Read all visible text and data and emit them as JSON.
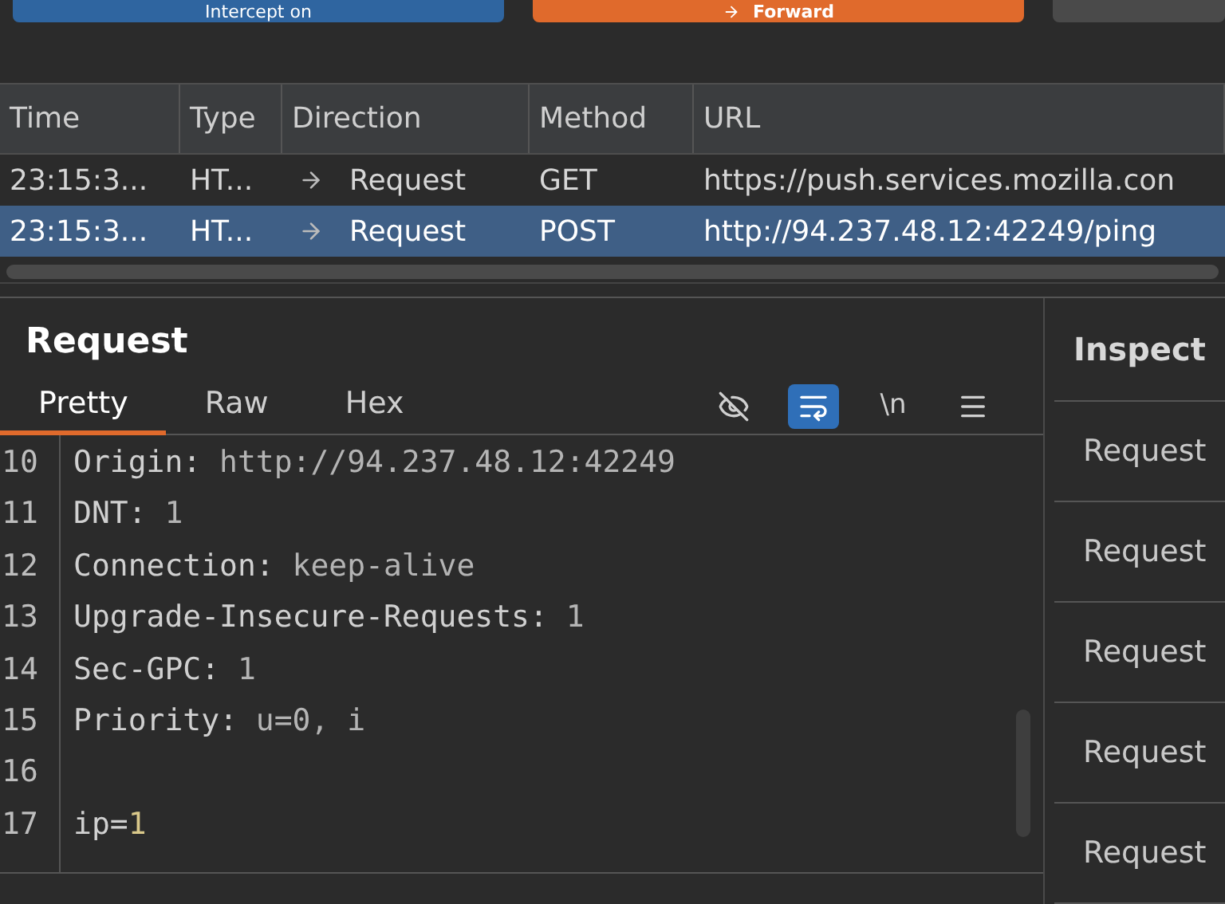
{
  "top_buttons": [
    {
      "label": "Intercept on",
      "kind": "intercept"
    },
    {
      "label": "Forward",
      "kind": "forward"
    },
    {
      "kind": "plain"
    }
  ],
  "table": {
    "columns": [
      "Time",
      "Type",
      "Direction",
      "Method",
      "URL"
    ],
    "rows": [
      {
        "cells": [
          "23:15:3...",
          "HT...",
          "Request",
          "GET",
          "https://push.services.mozilla.con"
        ],
        "selected": false
      },
      {
        "cells": [
          "23:15:3...",
          "HT...",
          "Request",
          "POST",
          "http://94.237.48.12:42249/ping"
        ],
        "selected": true
      }
    ]
  },
  "request": {
    "title": "Request",
    "tabs": [
      {
        "label": "Pretty",
        "selected": true
      },
      {
        "label": "Raw",
        "selected": false
      },
      {
        "label": "Hex",
        "selected": false
      }
    ],
    "tools": [
      {
        "kind": "hide",
        "selected": false
      },
      {
        "kind": "wrap",
        "selected": true
      },
      {
        "kind": "newline",
        "label": "\\n",
        "selected": false
      },
      {
        "kind": "menu",
        "selected": false
      }
    ],
    "lines": [
      {
        "number": "10",
        "parts": [
          {
            "text": "Origin: ",
            "kind": "key"
          },
          {
            "text": "http://94.237.48.12:42249",
            "kind": "value"
          }
        ]
      },
      {
        "number": "11",
        "parts": [
          {
            "text": "DNT: ",
            "kind": "key"
          },
          {
            "text": "1",
            "kind": "value"
          }
        ]
      },
      {
        "number": "12",
        "parts": [
          {
            "text": "Connection: ",
            "kind": "key"
          },
          {
            "text": "keep-alive",
            "kind": "value"
          }
        ]
      },
      {
        "number": "13",
        "parts": [
          {
            "text": "Upgrade-Insecure-Requests: ",
            "kind": "key"
          },
          {
            "text": "1",
            "kind": "value"
          }
        ]
      },
      {
        "number": "14",
        "parts": [
          {
            "text": "Sec-GPC: ",
            "kind": "key"
          },
          {
            "text": "1",
            "kind": "value"
          }
        ]
      },
      {
        "number": "15",
        "parts": [
          {
            "text": "Priority: ",
            "kind": "key"
          },
          {
            "text": "u=0, i",
            "kind": "value"
          }
        ]
      },
      {
        "number": "16"
      },
      {
        "number": "17",
        "parts": [
          {
            "text": "ip=",
            "kind": "key"
          },
          {
            "text": "1",
            "kind": "param"
          }
        ]
      }
    ]
  },
  "inspector": {
    "title": "Inspect",
    "items": [
      "Request",
      "Request",
      "Request",
      "Request",
      "Request"
    ]
  }
}
